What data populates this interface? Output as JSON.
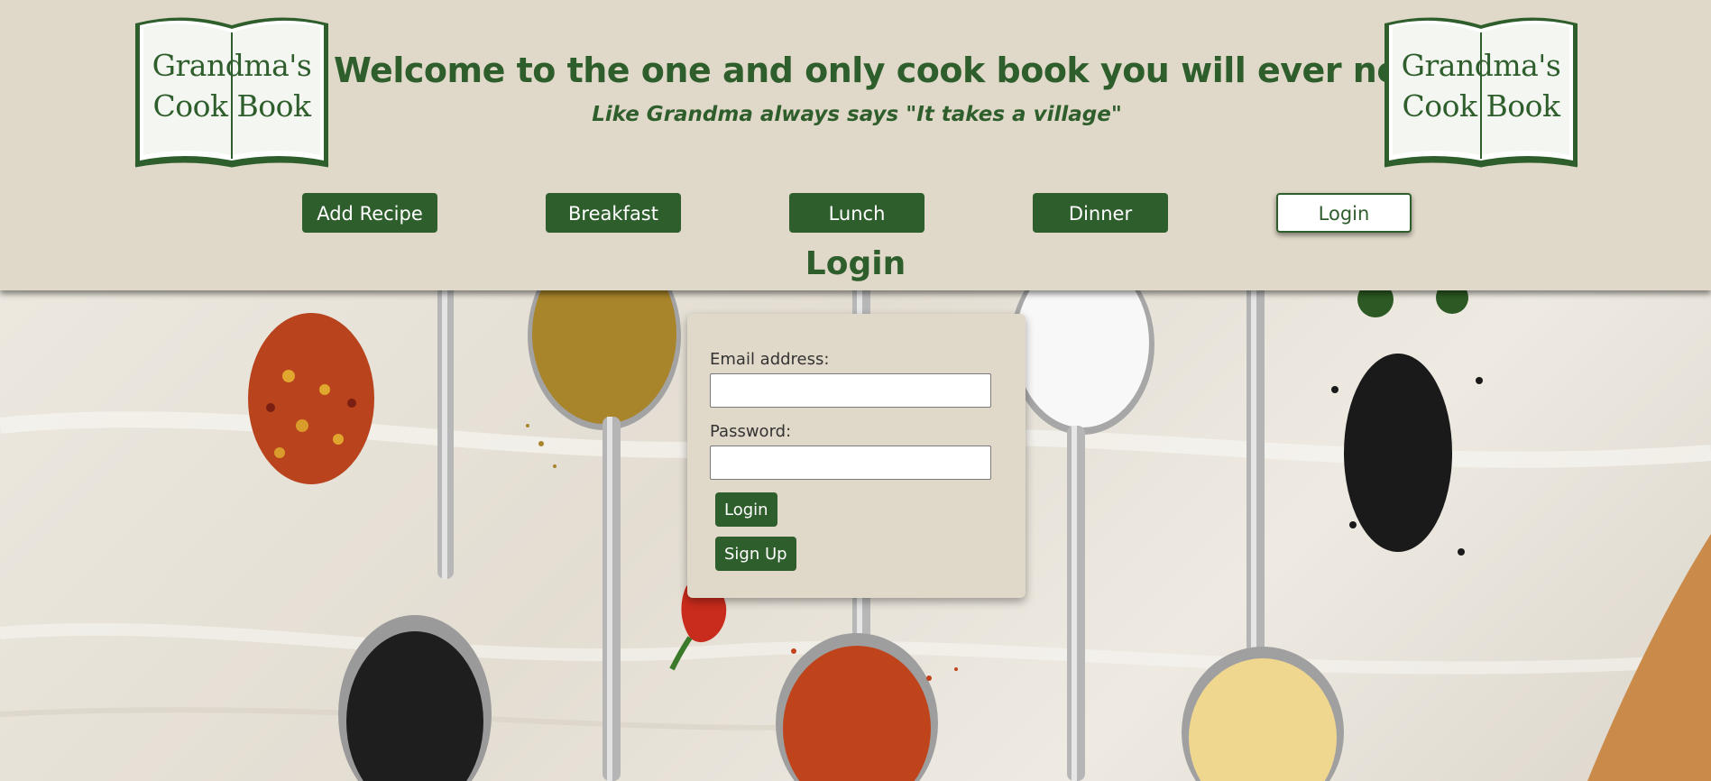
{
  "header": {
    "logo_line1": "Grandma's",
    "logo_line2": "Cook Book",
    "headline": "Welcome to the one and only cook book you will ever need!",
    "tagline": "Like Grandma always says \"It takes a village\""
  },
  "nav": {
    "items": [
      {
        "label": "Add Recipe"
      },
      {
        "label": "Breakfast"
      },
      {
        "label": "Lunch"
      },
      {
        "label": "Dinner"
      },
      {
        "label": "Login"
      }
    ],
    "active": "Login"
  },
  "page_title": "Login",
  "login_form": {
    "email_label": "Email address:",
    "email_value": "",
    "password_label": "Password:",
    "password_value": "",
    "login_button": "Login",
    "signup_button": "Sign Up"
  },
  "colors": {
    "brand_green": "#2f5e2d",
    "header_bg": "#e0d8c8",
    "button_text": "#ffffff"
  },
  "background_image": "spices-on-spoons"
}
